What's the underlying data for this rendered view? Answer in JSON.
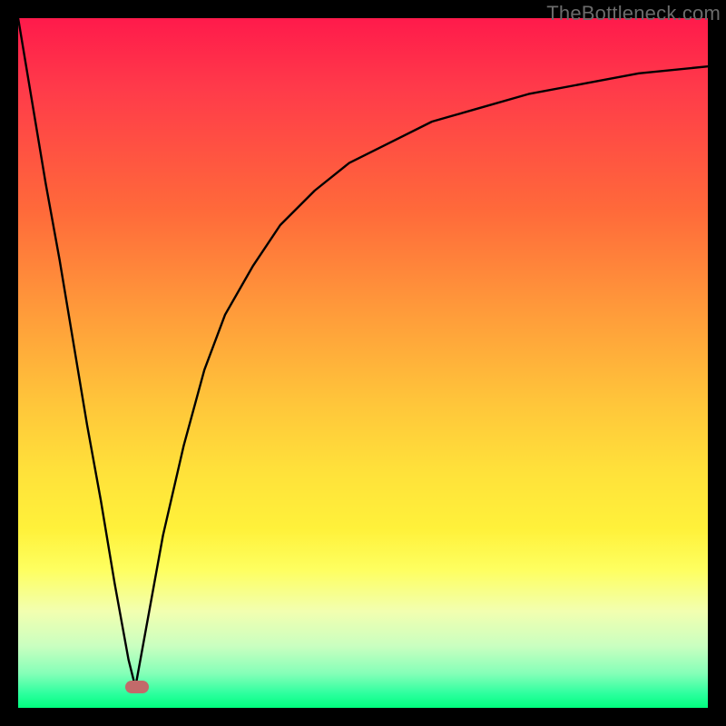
{
  "watermark": "TheBottleneck.com",
  "colors": {
    "frame": "#000000",
    "curve": "#000000",
    "marker": "#c26a6a",
    "gradient_stops": [
      "#ff1a4b",
      "#ff3a4a",
      "#ff6a3a",
      "#ff993a",
      "#ffc63a",
      "#ffe23a",
      "#fff13a",
      "#feff60",
      "#f2ffb0",
      "#caffc0",
      "#85ffb8",
      "#2bff9e",
      "#00fe7e"
    ]
  },
  "chart_data": {
    "type": "line",
    "title": "",
    "xlabel": "",
    "ylabel": "",
    "xlim": [
      0,
      100
    ],
    "ylim": [
      0,
      100
    ],
    "note": "x and y are in percent of plot-area; y=0 at bottom, y=100 at top. Two curve branches meeting at a minimum near x≈17.",
    "series": [
      {
        "name": "left-branch",
        "x": [
          0,
          2,
          4,
          6,
          8,
          10,
          12,
          14,
          16,
          17
        ],
        "y": [
          100,
          88,
          76,
          65,
          53,
          41,
          30,
          18,
          7,
          3
        ]
      },
      {
        "name": "right-branch",
        "x": [
          17,
          19,
          21,
          24,
          27,
          30,
          34,
          38,
          43,
          48,
          54,
          60,
          67,
          74,
          82,
          90,
          100
        ],
        "y": [
          3,
          14,
          25,
          38,
          49,
          57,
          64,
          70,
          75,
          79,
          82,
          85,
          87,
          89,
          90.5,
          92,
          93
        ]
      }
    ],
    "marker": {
      "x": 17.3,
      "y": 3,
      "label": ""
    }
  }
}
